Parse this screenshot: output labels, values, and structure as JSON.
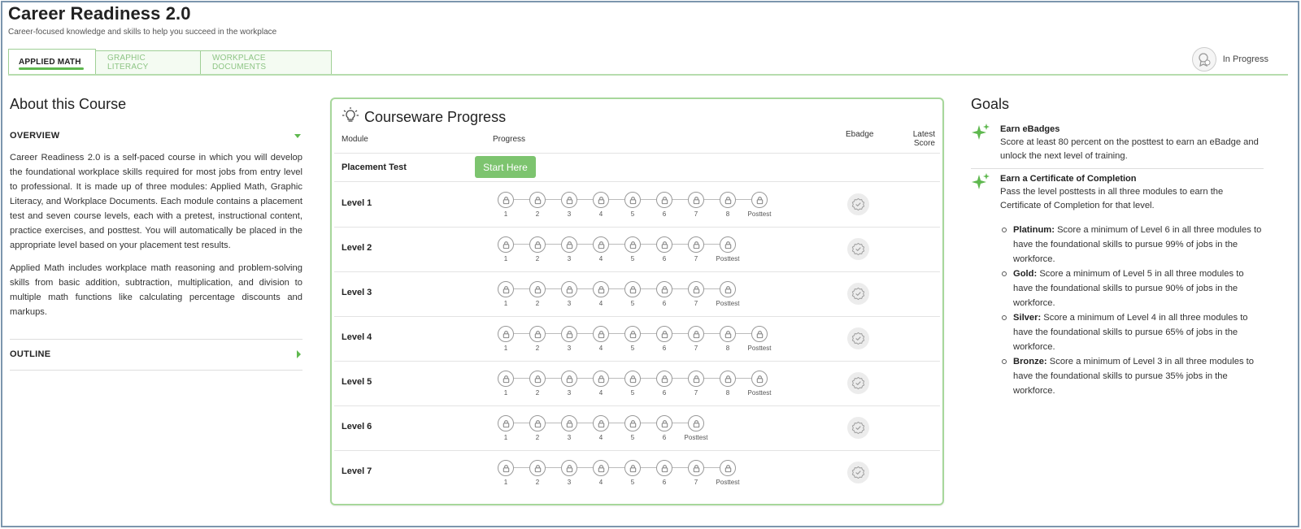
{
  "course": {
    "title": "Career Readiness 2.0",
    "subtitle": "Career-focused knowledge and skills to help you succeed in the workplace"
  },
  "tabs": [
    {
      "label": "APPLIED MATH",
      "active": true
    },
    {
      "label": "GRAPHIC LITERACY",
      "active": false
    },
    {
      "label": "WORKPLACE DOCUMENTS",
      "active": false
    }
  ],
  "status": {
    "label": "In Progress",
    "icon": "badge-progress-icon"
  },
  "about": {
    "heading": "About this Course",
    "overview_label": "OVERVIEW",
    "paragraph1": "Career Readiness 2.0 is a self-paced course in which you will develop the foundational workplace skills required for most jobs from entry level to professional. It is made up of three modules: Applied Math, Graphic Literacy, and Workplace Documents. Each module contains a placement test and seven course levels, each with a pretest, instructional content, practice exercises, and posttest. You will automatically be placed in the appropriate level based on your placement test results.",
    "paragraph2": "Applied Math includes workplace math reasoning and problem-solving skills from basic addition, subtraction, multiplication, and division to multiple math functions like calculating percentage discounts and markups.",
    "outline_label": "OUTLINE"
  },
  "progress": {
    "title": "Courseware Progress",
    "columns": {
      "module": "Module",
      "progress": "Progress",
      "ebadge": "Ebadge",
      "latest_score": "Latest Score"
    },
    "placement": {
      "label": "Placement Test",
      "button": "Start Here"
    },
    "levels": [
      {
        "label": "Level 1",
        "steps": [
          "1",
          "2",
          "3",
          "4",
          "5",
          "6",
          "7",
          "8",
          "Posttest"
        ]
      },
      {
        "label": "Level 2",
        "steps": [
          "1",
          "2",
          "3",
          "4",
          "5",
          "6",
          "7",
          "Posttest"
        ]
      },
      {
        "label": "Level 3",
        "steps": [
          "1",
          "2",
          "3",
          "4",
          "5",
          "6",
          "7",
          "Posttest"
        ]
      },
      {
        "label": "Level 4",
        "steps": [
          "1",
          "2",
          "3",
          "4",
          "5",
          "6",
          "7",
          "8",
          "Posttest"
        ]
      },
      {
        "label": "Level 5",
        "steps": [
          "1",
          "2",
          "3",
          "4",
          "5",
          "6",
          "7",
          "8",
          "Posttest"
        ]
      },
      {
        "label": "Level 6",
        "steps": [
          "1",
          "2",
          "3",
          "4",
          "5",
          "6",
          "Posttest"
        ]
      },
      {
        "label": "Level 7",
        "steps": [
          "1",
          "2",
          "3",
          "4",
          "5",
          "6",
          "7",
          "Posttest"
        ]
      }
    ]
  },
  "goals": {
    "heading": "Goals",
    "items": [
      {
        "title": "Earn eBadges",
        "desc": "Score at least 80 percent on the posttest to earn an eBadge and unlock the next level of training."
      },
      {
        "title": "Earn a Certificate of Completion",
        "desc": "Pass the level posttests in all three modules to earn the Certificate of Completion for that level."
      }
    ],
    "tiers": [
      {
        "name": "Platinum:",
        "text": " Score a minimum of Level 6 in all three modules to have the foundational skills to pursue 99% of jobs in the workforce."
      },
      {
        "name": "Gold:",
        "text": " Score a minimum of Level 5 in all three modules to have the foundational skills to pursue 90% of jobs in the workforce."
      },
      {
        "name": "Silver:",
        "text": " Score a minimum of Level 4 in all three modules to have the foundational skills to pursue 65% of jobs in the workforce."
      },
      {
        "name": "Bronze:",
        "text": " Score a minimum of Level 3 in all three modules to have the foundational skills to pursue 35% jobs in the workforce."
      }
    ]
  },
  "colors": {
    "accent": "#5fb84f",
    "accent_light": "#a7d79b",
    "button": "#7dc46f"
  }
}
